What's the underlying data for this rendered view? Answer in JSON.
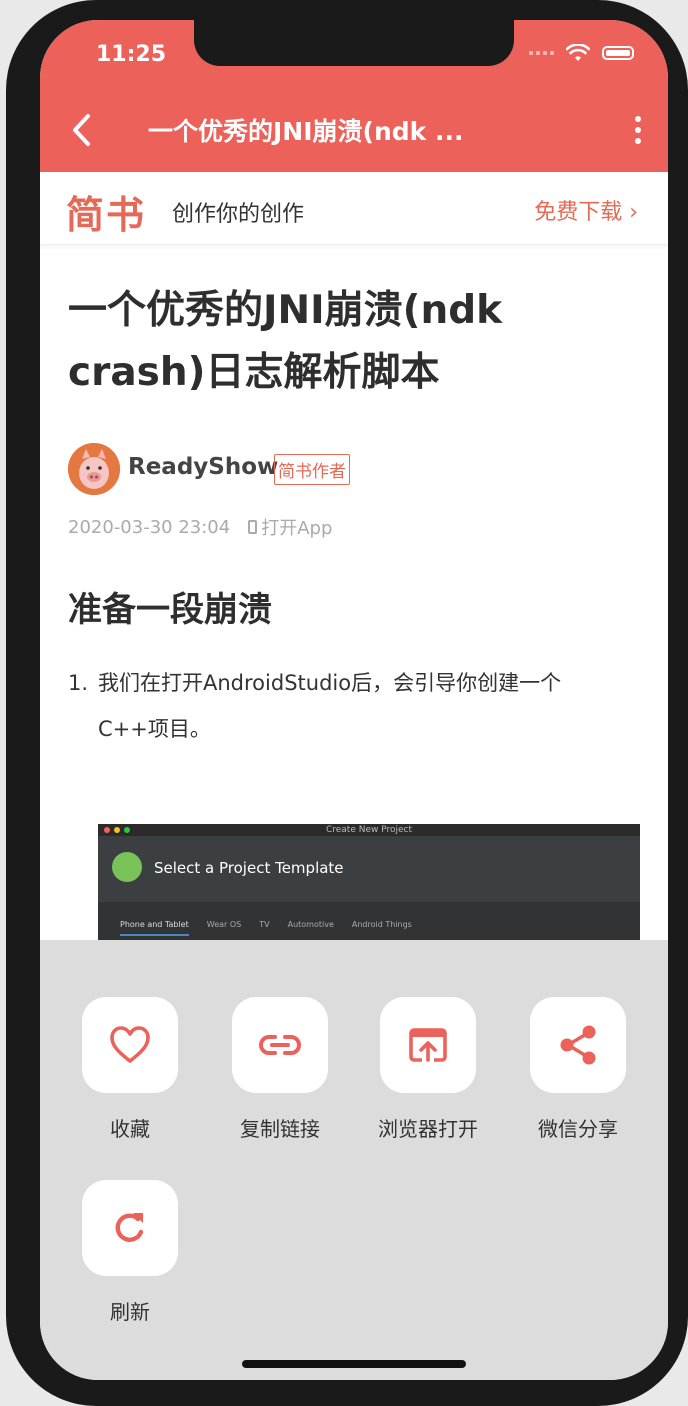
{
  "status": {
    "time": "11:25"
  },
  "nav": {
    "title": "一个优秀的JNI崩溃(ndk ..."
  },
  "banner": {
    "brand": "简书",
    "slogan": "创作你的创作",
    "download": "免费下载 ›"
  },
  "article": {
    "title_line1": "一个优秀的JNI崩溃(ndk",
    "title_line2": "crash)日志解析脚本",
    "author": "ReadyShow",
    "author_badge": "简书作者",
    "date": "2020-03-30 23:04",
    "open_app": "打开App",
    "heading": "准备一段崩溃",
    "list": [
      {
        "num": "1.",
        "text_line1": "我们在打开AndroidStudio后，会引导你创建一个",
        "text_line2": "C++项目。"
      }
    ],
    "screenshot": {
      "window_title": "Create New Project",
      "heading": "Select a Project Template",
      "tabs": [
        "Phone and Tablet",
        "Wear OS",
        "TV",
        "Automotive",
        "Android Things"
      ]
    }
  },
  "sheet": {
    "actions": [
      {
        "label": "收藏",
        "icon": "heart-icon"
      },
      {
        "label": "复制链接",
        "icon": "link-icon"
      },
      {
        "label": "浏览器打开",
        "icon": "open-in-browser-icon"
      },
      {
        "label": "微信分享",
        "icon": "share-icon"
      },
      {
        "label": "刷新",
        "icon": "refresh-icon"
      }
    ]
  },
  "colors": {
    "accent": "#ec615a",
    "brand": "#e46a57",
    "sheet_bg": "#dcdcdc"
  }
}
